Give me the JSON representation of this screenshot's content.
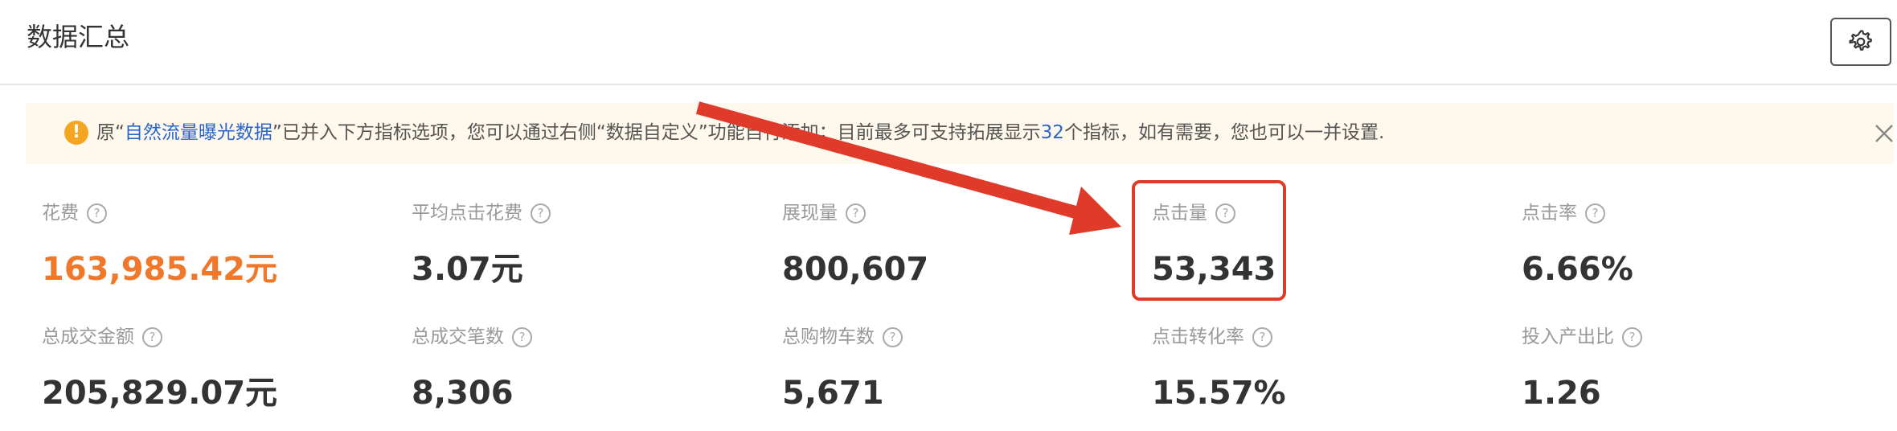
{
  "header": {
    "title": "数据汇总",
    "settings_icon": "gear-icon"
  },
  "notice": {
    "icon": "warning-icon",
    "text_prefix": "原“",
    "link_text": "自然流量曝光数据",
    "text_mid": "”已并入下方指标选项，您可以通过右侧“数据自定义”功能自行添加；目前最多可支持拓展显示",
    "count": "32",
    "text_suffix": "个指标，如有需要，您也可以一并设置.",
    "close_icon": "close-icon"
  },
  "metrics": [
    {
      "label": "花费",
      "value": "163,985.42元",
      "color": "#f0782b"
    },
    {
      "label": "平均点击花费",
      "value": "3.07元"
    },
    {
      "label": "展现量",
      "value": "800,607"
    },
    {
      "label": "点击量",
      "value": "53,343",
      "highlighted": true
    },
    {
      "label": "点击率",
      "value": "6.66%"
    },
    {
      "label": "总成交金额",
      "value": "205,829.07元"
    },
    {
      "label": "总成交笔数",
      "value": "8,306"
    },
    {
      "label": "总购物车数",
      "value": "5,671"
    },
    {
      "label": "点击转化率",
      "value": "15.57%"
    },
    {
      "label": "投入产出比",
      "value": "1.26"
    }
  ],
  "help_glyph": "?",
  "annotation": {
    "color": "#e03a2a"
  }
}
